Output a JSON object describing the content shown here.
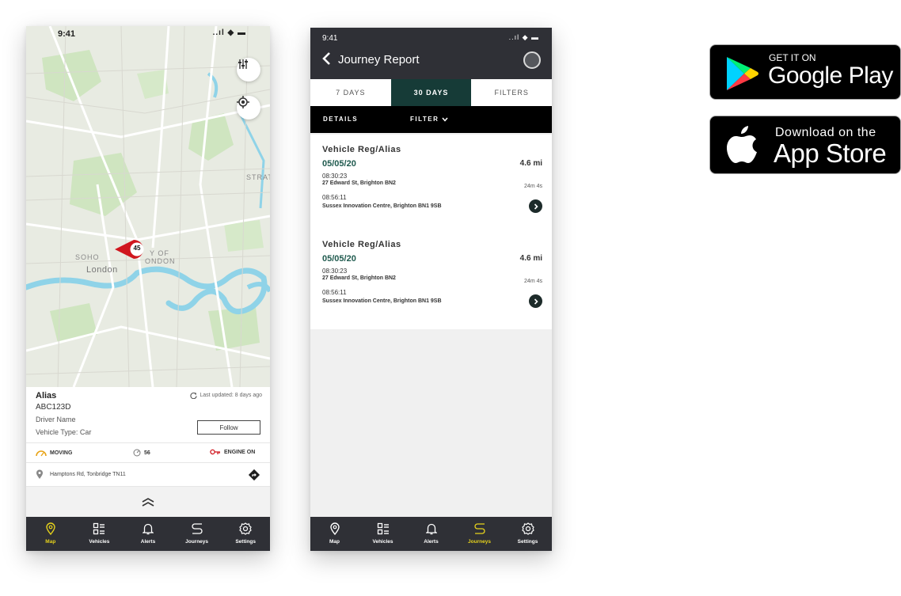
{
  "map_screen": {
    "status_time": "9:41",
    "status_signal": "..ıl ◆ ▬",
    "map_labels": {
      "soho": "SOHO",
      "london": "London",
      "city": "Y OF",
      "ndon": "ONDON",
      "stratford": "STRAT"
    },
    "vehicle_speed": "45",
    "info": {
      "alias": "Alias",
      "registration": "ABC123D",
      "driver": "Driver Name",
      "vehicle_type": "Vehicle Type: Car",
      "last_updated": "Last updated: 8 days ago",
      "follow_label": "Follow",
      "status_moving": "MOVING",
      "status_speed": "56",
      "status_engine": "ENGINE ON",
      "address": "Hamptons Rd, Tonbridge TN11"
    },
    "tabs": [
      {
        "label": "Map",
        "icon": "map-pin-icon"
      },
      {
        "label": "Vehicles",
        "icon": "vehicles-icon"
      },
      {
        "label": "Alerts",
        "icon": "bell-icon"
      },
      {
        "label": "Journeys",
        "icon": "route-icon"
      },
      {
        "label": "Settings",
        "icon": "gear-icon"
      }
    ]
  },
  "report_screen": {
    "status_time": "9:41",
    "status_signal": "..ıl ◆ ▬",
    "title": "Journey Report",
    "segments": [
      "7 DAYS",
      "30 DAYS",
      "FILTERS"
    ],
    "details_label": "DETAILS",
    "filter_label": "FILTER",
    "journeys": [
      {
        "vehicle": "Vehicle Reg/Alias",
        "date": "05/05/20",
        "distance": "4.6 mi",
        "start_time": "08:30:23",
        "start_address": "27 Edward St, Brighton BN2",
        "duration": "24m 4s",
        "end_time": "08:56:11",
        "end_address": "Sussex Innovation Centre, Brighton BN1 9SB"
      },
      {
        "vehicle": "Vehicle Reg/Alias",
        "date": "05/05/20",
        "distance": "4.6 mi",
        "start_time": "08:30:23",
        "start_address": "27 Edward St, Brighton BN2",
        "duration": "24m 4s",
        "end_time": "08:56:11",
        "end_address": "Sussex Innovation Centre, Brighton BN1 9SB"
      }
    ],
    "tabs": [
      {
        "label": "Map",
        "icon": "map-pin-icon"
      },
      {
        "label": "Vehicles",
        "icon": "vehicles-icon"
      },
      {
        "label": "Alerts",
        "icon": "bell-icon"
      },
      {
        "label": "Journeys",
        "icon": "route-icon"
      },
      {
        "label": "Settings",
        "icon": "gear-icon"
      }
    ]
  },
  "badges": {
    "google_small": "GET IT ON",
    "google_big": "Google Play",
    "apple_small": "Download on the",
    "apple_big": "App Store"
  },
  "colors": {
    "dark_bar": "#2f3036",
    "active_segment": "#163b37",
    "active_tab": "#e6d21c",
    "marker_red": "#d0161e",
    "river": "#8fd3e8"
  }
}
